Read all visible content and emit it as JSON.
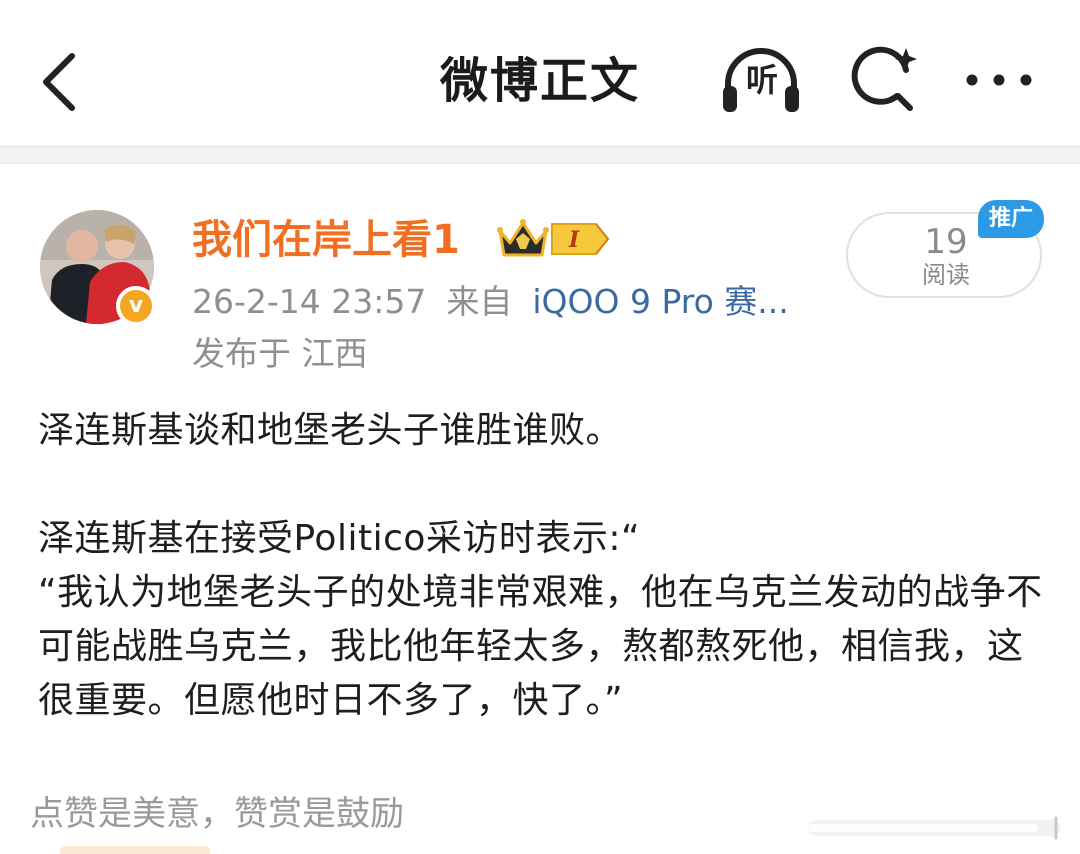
{
  "header": {
    "title": "微博正文",
    "listen_label": "听",
    "back_icon": "chevron-left-icon",
    "search_icon": "search-sparkle-icon",
    "more_icon": "more-dots-icon"
  },
  "post": {
    "author": {
      "name": "我们在岸上看1",
      "verified_mark": "v",
      "member_badge": "I",
      "avatar_icon": "user-avatar"
    },
    "timestamp": "26-2-14 23:57",
    "source_label": "来自",
    "source_device": "iQOO 9 Pro 赛...",
    "location": "发布于 江西",
    "reads": {
      "count": "19",
      "label": "阅读"
    },
    "promo_label": "推广",
    "paragraphs": [
      "泽连斯基谈和地堡老头子谁胜谁败。",
      "泽连斯基在接受Politico采访时表示:“",
      "“我认为地堡老头子的处境非常艰难，他在乌克兰发动的战争不可能战胜乌克兰，我比他年轻太多，熬都熬死他，相信我，这很重要。但愿他时日不多了，快了。”"
    ]
  },
  "reward": {
    "text": "点赞是美意，赞赏是鼓励"
  },
  "colors": {
    "username": "#f26f22",
    "source_link": "#3b6aa1",
    "promo": "#2d9ae6",
    "verify": "#f5a623",
    "meta_text": "#8f8f8f"
  }
}
